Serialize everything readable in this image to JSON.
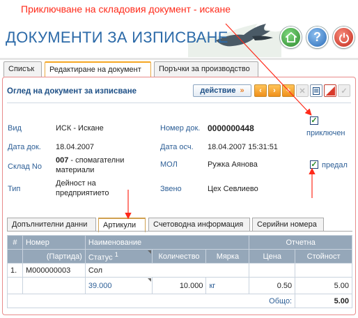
{
  "annotation": {
    "text": "Приключване на складовия документ - искане",
    "color": "#ff2a1a"
  },
  "app": {
    "title": "ДОКУМЕНТИ ЗА ИЗПИСВАНЕ",
    "header_buttons": [
      "home-icon",
      "help-icon",
      "power-icon"
    ],
    "help_glyph": "?"
  },
  "tabs": [
    {
      "label": "Списък",
      "active": false
    },
    {
      "label": "Редактиране на документ",
      "active": true
    },
    {
      "label": "Поръчки за производство",
      "active": false
    }
  ],
  "panel": {
    "title": "Оглед на документ за изписване",
    "action_label": "действие",
    "action_chevron": "»"
  },
  "toolbar": [
    {
      "name": "prev-icon",
      "glyph": "‹",
      "enabled": true
    },
    {
      "name": "next-icon",
      "glyph": "›",
      "enabled": true
    },
    {
      "name": "add-icon",
      "glyph": "+",
      "enabled": true
    },
    {
      "name": "delete-icon",
      "glyph": "✕",
      "enabled": false
    },
    {
      "name": "print-icon",
      "glyph": "",
      "enabled": true
    },
    {
      "name": "cancel-icon",
      "glyph": "",
      "enabled": true
    },
    {
      "name": "confirm-icon",
      "glyph": "✓",
      "enabled": false
    }
  ],
  "fields": {
    "vid_label": "Вид",
    "vid_value": "ИСК - Искане",
    "nomer_label": "Номер док.",
    "nomer_value": "0000000448",
    "data_label": "Дата док.",
    "data_value": "18.04.2007",
    "data_osch_label": "Дата осч.",
    "data_osch_value": "18.04.2007 15:31:51",
    "sklad_label": "Склад No",
    "sklad_code": "007",
    "sklad_name": " - спомагателни материали",
    "mol_label": "МОЛ",
    "mol_value": "Ружка Аянова",
    "tip_label": "Тип",
    "tip_value": "Дейност на предприятието",
    "zveno_label": "Звено",
    "zveno_value": "Цех Севлиево"
  },
  "checkboxes": {
    "closed_label": "приключен",
    "closed_checked": true,
    "handed_label": "предал",
    "handed_checked": true
  },
  "sub_tabs": [
    {
      "label": "Допълнителни данни",
      "active": false
    },
    {
      "label": "Артикули",
      "active": true
    },
    {
      "label": "Счетоводна информация",
      "active": false
    },
    {
      "label": "Серийни номера",
      "active": false
    }
  ],
  "grid": {
    "header1": {
      "hash": "#",
      "number": "Номер",
      "name": "Наименование",
      "report": "Отчетна"
    },
    "header2": {
      "batch": "(Партида)",
      "status": "Статус",
      "status_sup": "1",
      "quantity": "Количество",
      "unit": "Мярка",
      "price": "Цена",
      "value": "Стойност"
    },
    "row": {
      "index": "1.",
      "number": "М000000003",
      "name": "Сол"
    },
    "subrow": {
      "batch": "39.000",
      "quantity": "10.000",
      "unit": "кг",
      "price": "0.50",
      "value": "5.00"
    },
    "total_label": "Общо:",
    "total_value": "5.00"
  }
}
